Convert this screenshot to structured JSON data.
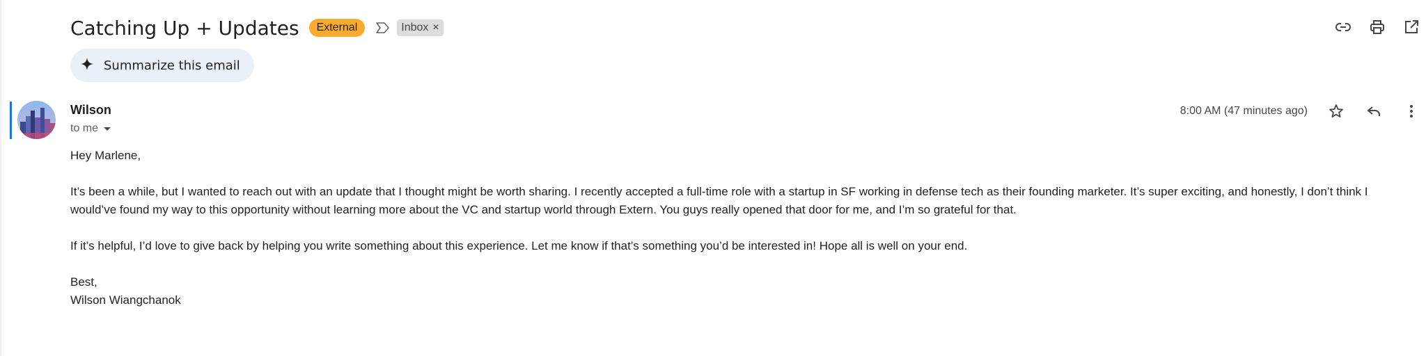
{
  "email": {
    "subject": "Catching Up + Updates",
    "external_badge": "External",
    "label_icon": "label-arrow-icon",
    "inbox_chip": "Inbox",
    "inbox_chip_close": "×",
    "summarize_label": "Summarize this email",
    "sender": "Wilson",
    "to_line": "to me",
    "timestamp": "8:00 AM (47 minutes ago)",
    "greeting": "Hey Marlene,",
    "paragraph1": "It’s been a while, but I wanted to reach out with an update that I thought might be worth sharing. I recently accepted a full-time role with a startup in SF working in defense tech as their founding marketer. It’s super exciting, and honestly, I don’t think I would’ve found my way to this opportunity without learning more about the VC and startup world through Extern. You guys really opened that door for me, and I’m so grateful for that.",
    "paragraph2": "If it’s helpful, I’d love to give back by helping you write something about this experience. Let me know if that’s something you’d be interested in! Hope all is well on your end.",
    "signoff": "Best,",
    "signature": "Wilson Wiangchanok"
  },
  "icons": {
    "top": [
      "link-icon",
      "print-icon",
      "open-in-new-window-icon"
    ],
    "message": [
      "star-icon",
      "reply-icon",
      "more-vert-icon"
    ]
  },
  "colors": {
    "external_badge": "#f9ab2e",
    "inbox_chip": "#dddddd",
    "summarize_bg": "#eaf0f7",
    "thread_bar": "#1a73e8"
  }
}
